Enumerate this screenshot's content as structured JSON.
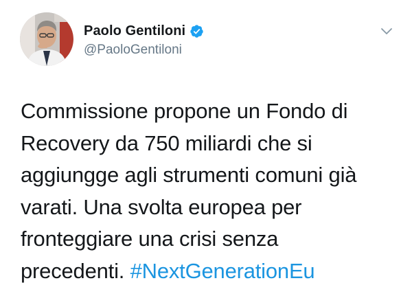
{
  "author": {
    "display_name": "Paolo Gentiloni",
    "handle": "@PaoloGentiloni",
    "verified": true,
    "avatar_icon": "profile-photo"
  },
  "menu": {
    "icon": "chevron-down-icon"
  },
  "tweet": {
    "lines": [
      "Commissione propone un Fondo di",
      "Recovery da 750 miliardi che si",
      "aggiungge agli strumenti comuni già",
      "varati. Una svolta europea per",
      "fronteggiare una crisi senza"
    ],
    "last_line_text": "precedenti. ",
    "hashtag": "#NextGenerationEu"
  },
  "colors": {
    "text": "#14171a",
    "secondary": "#657786",
    "link": "#1b95e0",
    "verified_badge": "#1da1f2"
  }
}
